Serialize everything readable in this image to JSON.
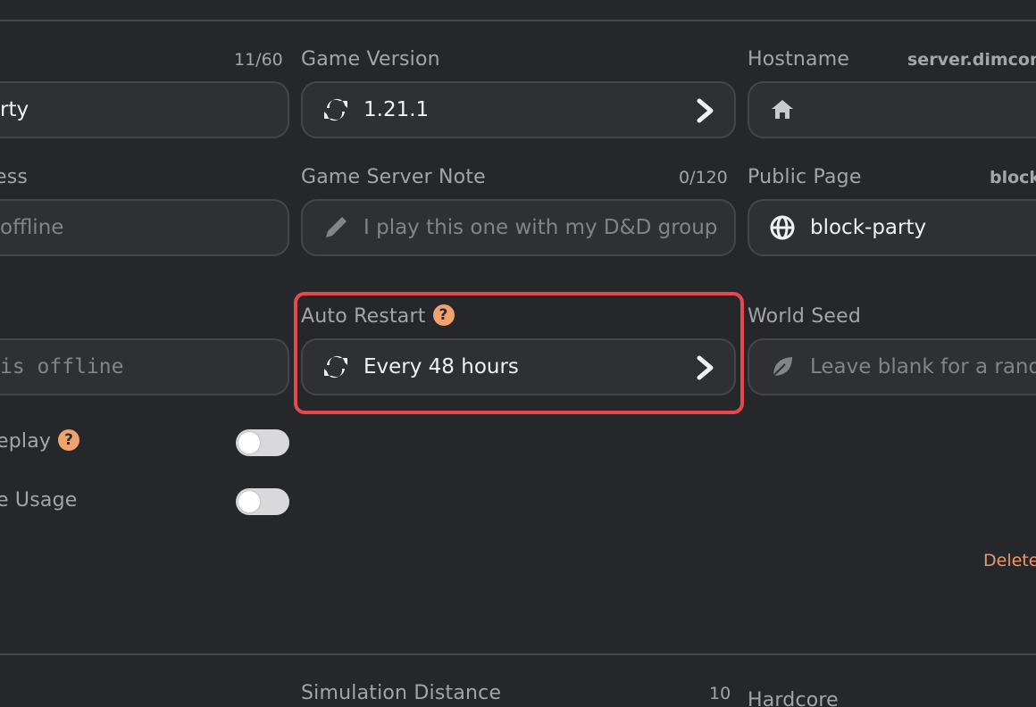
{
  "colors": {
    "background": "#26272b",
    "field_bg": "#2f3034",
    "field_border": "#45464b",
    "help_badge": "#f0a36d",
    "highlight": "#e5484d",
    "danger_link": "#e89a6c"
  },
  "column1": {
    "name_counter": "11/60",
    "name_value": "rty",
    "address_label": "ess",
    "address_placeholder": "offline",
    "message_placeholder": "is offline",
    "replay_label": "eplay",
    "usage_label": "e Usage"
  },
  "game_version": {
    "label": "Game Version",
    "value": "1.21.1",
    "icon": "refresh-icon"
  },
  "note": {
    "label": "Game Server Note",
    "counter": "0/120",
    "placeholder": "I play this one with my D&D group",
    "icon": "pencil-icon"
  },
  "auto_restart": {
    "label": "Auto Restart",
    "help": "?",
    "value": "Every 48 hours",
    "icon": "refresh-icon"
  },
  "hostname": {
    "label": "Hostname",
    "value": "server.dimcon",
    "icon": "home-icon"
  },
  "public_page": {
    "label": "Public Page",
    "meta": "block",
    "value": "block-party",
    "icon": "globe-icon"
  },
  "world_seed": {
    "label": "World Seed",
    "placeholder": "Leave blank for a rando",
    "icon": "leaf-icon"
  },
  "delete_link": "Delete",
  "lower_section": {
    "simulation_distance_label": "Simulation Distance",
    "simulation_distance_value": "10",
    "hardcore_label": "Hardcore"
  }
}
